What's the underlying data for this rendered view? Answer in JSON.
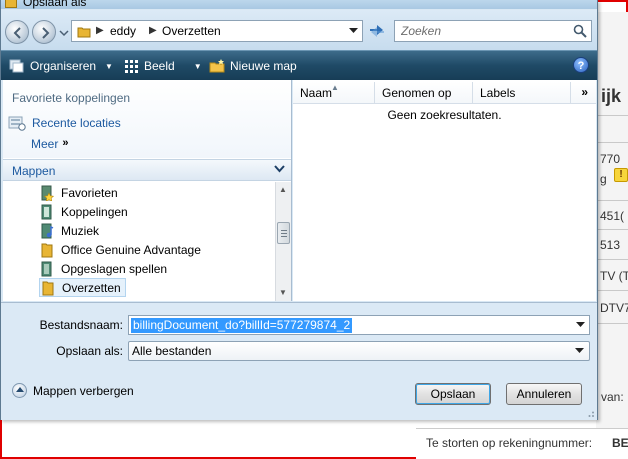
{
  "dialog": {
    "title": "Opslaan als"
  },
  "address": {
    "crumbs": [
      "eddy",
      "Overzetten"
    ],
    "search_placeholder": "Zoeken"
  },
  "toolbar": {
    "organize": "Organiseren",
    "view": "Beeld",
    "new_folder": "Nieuwe map",
    "help": "?"
  },
  "nav": {
    "favorites_title": "Favoriete koppelingen",
    "recent": "Recente locaties",
    "more": "Meer",
    "more_chevron": "»",
    "folders_title": "Mappen",
    "tree": [
      {
        "label": "Favorieten",
        "icon": "star-folder-icon"
      },
      {
        "label": "Koppelingen",
        "icon": "links-folder-icon"
      },
      {
        "label": "Muziek",
        "icon": "music-folder-icon"
      },
      {
        "label": "Office Genuine Advantage",
        "icon": "folder-icon"
      },
      {
        "label": "Opgeslagen spellen",
        "icon": "games-folder-icon"
      },
      {
        "label": "Overzetten",
        "icon": "folder-icon",
        "selected": true
      }
    ]
  },
  "files": {
    "columns": [
      "Naam",
      "Genomen op",
      "Labels"
    ],
    "more": "»",
    "empty_text": "Geen zoekresultaten."
  },
  "form": {
    "filename_label": "Bestandsnaam:",
    "filename_value": "billingDocument_do?billId=577279874_2",
    "savetype_label": "Opslaan als:",
    "savetype_value": "Alle bestanden"
  },
  "footer": {
    "hide_folders": "Mappen verbergen",
    "save": "Opslaan",
    "cancel": "Annuleren"
  },
  "background": {
    "fragments": [
      "ijk",
      "770",
      "g",
      "451(",
      "513",
      "TV (T",
      "DTV7",
      "van:"
    ],
    "bottom_line": "Te storten op rekeningnummer:",
    "bottom_bold": "BE"
  },
  "colors": {
    "toolbar": "#1f4a66",
    "link": "#1d5aa0",
    "selection": "#3399ff",
    "frame_red": "#e00000"
  }
}
